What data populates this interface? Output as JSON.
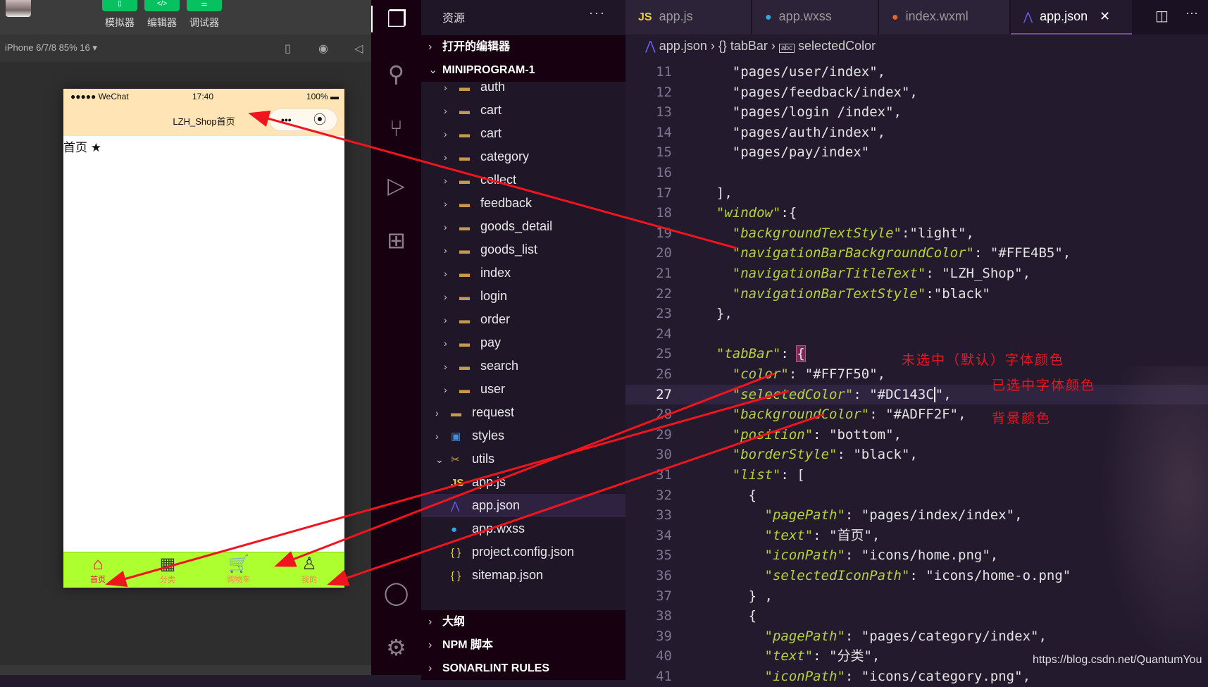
{
  "simulator": {
    "toolbar": [
      {
        "label": "模拟器",
        "icon": "phone-icon"
      },
      {
        "label": "编辑器",
        "icon": "code-icon"
      },
      {
        "label": "调试器",
        "icon": "sliders-icon"
      }
    ],
    "device": "iPhone 6/7/8 85% 16 ▾",
    "status": {
      "signal": "●●●●● WeChat",
      "time": "17:40",
      "battery": "100%"
    },
    "nav_title": "LZH_Shop首页",
    "capsule": {
      "more": "•••",
      "close": "⦿"
    },
    "content": "首页 ★",
    "colors": {
      "nav": "#FFE4B5",
      "tab_bg": "#ADFF2F",
      "tab_color": "#FF7F50",
      "tab_selected": "#DC143C"
    },
    "tabs": [
      {
        "label": "首页",
        "icon": "⌂",
        "selected": true
      },
      {
        "label": "分类",
        "icon": "▦"
      },
      {
        "label": "购物车",
        "icon": "🛒"
      },
      {
        "label": "我的",
        "icon": "♙"
      }
    ]
  },
  "explorer": {
    "title": "资源",
    "more": "···",
    "open_editors": "打开的编辑器",
    "project": "MINIPROGRAM-1",
    "items": [
      {
        "name": "auth",
        "type": "folder",
        "depth": 2
      },
      {
        "name": "cart",
        "type": "folder",
        "depth": 2
      },
      {
        "name": "cart",
        "type": "folder",
        "depth": 2
      },
      {
        "name": "category",
        "type": "folder",
        "depth": 2
      },
      {
        "name": "collect",
        "type": "folder",
        "depth": 2
      },
      {
        "name": "feedback",
        "type": "folder",
        "depth": 2
      },
      {
        "name": "goods_detail",
        "type": "folder",
        "depth": 2
      },
      {
        "name": "goods_list",
        "type": "folder",
        "depth": 2
      },
      {
        "name": "index",
        "type": "folder",
        "depth": 2
      },
      {
        "name": "login",
        "type": "folder",
        "depth": 2
      },
      {
        "name": "order",
        "type": "folder",
        "depth": 2
      },
      {
        "name": "pay",
        "type": "folder",
        "depth": 2
      },
      {
        "name": "search",
        "type": "folder",
        "depth": 2
      },
      {
        "name": "user",
        "type": "folder",
        "depth": 2
      },
      {
        "name": "request",
        "type": "folder",
        "depth": 1
      },
      {
        "name": "styles",
        "type": "styles",
        "depth": 1
      },
      {
        "name": "utils",
        "type": "utils",
        "depth": 1,
        "expanded": true
      },
      {
        "name": "app.js",
        "type": "js",
        "depth": 1
      },
      {
        "name": "app.json",
        "type": "json-app",
        "depth": 1,
        "selected": true
      },
      {
        "name": "app.wxss",
        "type": "wxss",
        "depth": 1
      },
      {
        "name": "project.config.json",
        "type": "json",
        "depth": 1
      },
      {
        "name": "sitemap.json",
        "type": "json",
        "depth": 1
      }
    ],
    "sections": [
      "大纲",
      "NPM 脚本",
      "SONARLINT RULES"
    ]
  },
  "editor": {
    "tabs": [
      {
        "label": "app.js",
        "icon": "JS"
      },
      {
        "label": "app.wxss",
        "icon": "wechat"
      },
      {
        "label": "index.wxml",
        "icon": "wechat"
      },
      {
        "label": "app.json",
        "icon": "json",
        "active": true
      }
    ],
    "close": "✕",
    "breadcrumb": [
      "app.json",
      "{} tabBar",
      "selectedColor"
    ],
    "current_line": 27,
    "lines": [
      {
        "n": 11,
        "p": [
          [
            "s",
            "    \"pages/user/index\","
          ]
        ]
      },
      {
        "n": 12,
        "p": [
          [
            "s",
            "    \"pages/feedback/index\","
          ]
        ]
      },
      {
        "n": 13,
        "p": [
          [
            "s",
            "    \"pages/login /index\","
          ]
        ]
      },
      {
        "n": 14,
        "p": [
          [
            "s",
            "    \"pages/auth/index\","
          ]
        ]
      },
      {
        "n": 15,
        "p": [
          [
            "s",
            "    \"pages/pay/index\""
          ]
        ]
      },
      {
        "n": 16,
        "p": []
      },
      {
        "n": 17,
        "p": [
          [
            "s",
            "  ],"
          ]
        ]
      },
      {
        "n": 18,
        "p": [
          [
            "s",
            "  "
          ],
          [
            "k",
            "\"window\""
          ],
          [
            "s",
            ":{"
          ]
        ]
      },
      {
        "n": 19,
        "p": [
          [
            "s",
            "    "
          ],
          [
            "k",
            "\"backgroundTextStyle\""
          ],
          [
            "s",
            ":\"light\","
          ]
        ]
      },
      {
        "n": 20,
        "p": [
          [
            "s",
            "    "
          ],
          [
            "k",
            "\"navigationBarBackgroundColor\""
          ],
          [
            "s",
            ": \"#FFE4B5\","
          ]
        ]
      },
      {
        "n": 21,
        "p": [
          [
            "s",
            "    "
          ],
          [
            "k",
            "\"navigationBarTitleText\""
          ],
          [
            "s",
            ": \"LZH_Shop\","
          ]
        ]
      },
      {
        "n": 22,
        "p": [
          [
            "s",
            "    "
          ],
          [
            "k",
            "\"navigationBarTextStyle\""
          ],
          [
            "s",
            ":\"black\""
          ]
        ]
      },
      {
        "n": 23,
        "p": [
          [
            "s",
            "  },"
          ]
        ]
      },
      {
        "n": 24,
        "p": []
      },
      {
        "n": 25,
        "p": [
          [
            "s",
            "  "
          ],
          [
            "k",
            "\"tabBar\""
          ],
          [
            "s",
            ": "
          ],
          [
            "b",
            "{"
          ]
        ]
      },
      {
        "n": 26,
        "p": [
          [
            "s",
            "    "
          ],
          [
            "k",
            "\"color\""
          ],
          [
            "s",
            ": \"#FF7F50\","
          ]
        ]
      },
      {
        "n": 27,
        "p": [
          [
            "s",
            "    "
          ],
          [
            "k",
            "\"selectedColor\""
          ],
          [
            "s",
            ": \"#DC143"
          ],
          [
            "c",
            "C"
          ],
          [
            "s",
            "\","
          ]
        ]
      },
      {
        "n": 28,
        "p": [
          [
            "s",
            "    "
          ],
          [
            "k",
            "\"backgroundColor\""
          ],
          [
            "s",
            ": \"#ADFF2F\","
          ]
        ]
      },
      {
        "n": 29,
        "p": [
          [
            "s",
            "    "
          ],
          [
            "k",
            "\"position\""
          ],
          [
            "s",
            ": \"bottom\","
          ]
        ]
      },
      {
        "n": 30,
        "p": [
          [
            "s",
            "    "
          ],
          [
            "k",
            "\"borderStyle\""
          ],
          [
            "s",
            ": \"black\","
          ]
        ]
      },
      {
        "n": 31,
        "p": [
          [
            "s",
            "    "
          ],
          [
            "k",
            "\"list\""
          ],
          [
            "s",
            ": ["
          ]
        ]
      },
      {
        "n": 32,
        "p": [
          [
            "s",
            "      {"
          ]
        ]
      },
      {
        "n": 33,
        "p": [
          [
            "s",
            "        "
          ],
          [
            "k",
            "\"pagePath\""
          ],
          [
            "s",
            ": \"pages/index/index\","
          ]
        ]
      },
      {
        "n": 34,
        "p": [
          [
            "s",
            "        "
          ],
          [
            "k",
            "\"text\""
          ],
          [
            "s",
            ": \"首页\","
          ]
        ]
      },
      {
        "n": 35,
        "p": [
          [
            "s",
            "        "
          ],
          [
            "k",
            "\"iconPath\""
          ],
          [
            "s",
            ": \"icons/home.png\","
          ]
        ]
      },
      {
        "n": 36,
        "p": [
          [
            "s",
            "        "
          ],
          [
            "k",
            "\"selectedIconPath\""
          ],
          [
            "s",
            ": \"icons/home-o.png\""
          ]
        ]
      },
      {
        "n": 37,
        "p": [
          [
            "s",
            "      } ,"
          ]
        ]
      },
      {
        "n": 38,
        "p": [
          [
            "s",
            "      {"
          ]
        ]
      },
      {
        "n": 39,
        "p": [
          [
            "s",
            "        "
          ],
          [
            "k",
            "\"pagePath\""
          ],
          [
            "s",
            ": \"pages/category/index\","
          ]
        ]
      },
      {
        "n": 40,
        "p": [
          [
            "s",
            "        "
          ],
          [
            "k",
            "\"text\""
          ],
          [
            "s",
            ": \"分类\","
          ]
        ]
      },
      {
        "n": 41,
        "p": [
          [
            "s",
            "        "
          ],
          [
            "k",
            "\"iconPath\""
          ],
          [
            "s",
            ": \"icons/category.png\","
          ]
        ]
      }
    ]
  },
  "annotations": [
    "未选中（默认）字体颜色",
    "已选中字体颜色",
    "背景颜色"
  ],
  "annotation_color": "#F0141E",
  "watermark": "https://blog.csdn.net/QuantumYou"
}
